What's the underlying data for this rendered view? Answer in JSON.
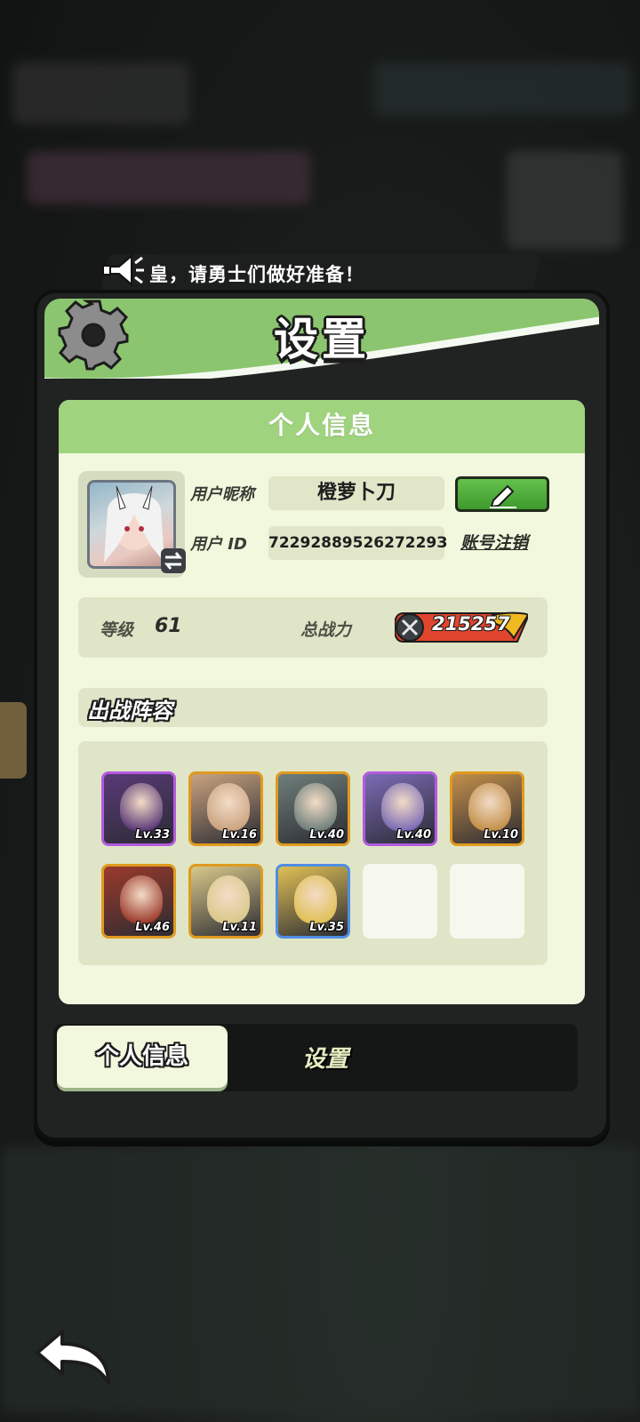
{
  "banner": {
    "text": "皇，请勇士们做好准备！"
  },
  "panel": {
    "title": "设置"
  },
  "card": {
    "header": "个人信息",
    "nickname_label": "用户昵称",
    "nickname_value": "橙萝卜刀",
    "id_label": "用户 ID",
    "id_value": "7229288952627229З",
    "cancel_account": "账号注销",
    "level_label": "等级",
    "level_value": "61",
    "power_label": "总战力",
    "power_value": "215257",
    "lineup_title": "出战阵容",
    "heroes": [
      {
        "level": "Lv.33",
        "frame": "purple",
        "color": "#5a3a78"
      },
      {
        "level": "Lv.16",
        "frame": "orange",
        "color": "#c9a37f"
      },
      {
        "level": "Lv.40",
        "frame": "orange",
        "color": "#6f7f7a"
      },
      {
        "level": "Lv.40",
        "frame": "purple",
        "color": "#7b6bb6"
      },
      {
        "level": "Lv.10",
        "frame": "orange",
        "color": "#c38f4a"
      },
      {
        "level": "Lv.46",
        "frame": "orange",
        "color": "#9b3a2b"
      },
      {
        "level": "Lv.11",
        "frame": "orange",
        "color": "#d9c98a"
      },
      {
        "level": "Lv.35",
        "frame": "blue",
        "color": "#e0c055"
      },
      {
        "level": "",
        "frame": "empty",
        "color": "#f6f8ee"
      },
      {
        "level": "",
        "frame": "empty",
        "color": "#f6f8ee"
      }
    ]
  },
  "tabs": {
    "active": "个人信息",
    "inactive": "设置"
  },
  "colors": {
    "header_green": "#8bc56f",
    "card_bg": "#f1f8dd",
    "edit_green": "#4caf3a"
  }
}
